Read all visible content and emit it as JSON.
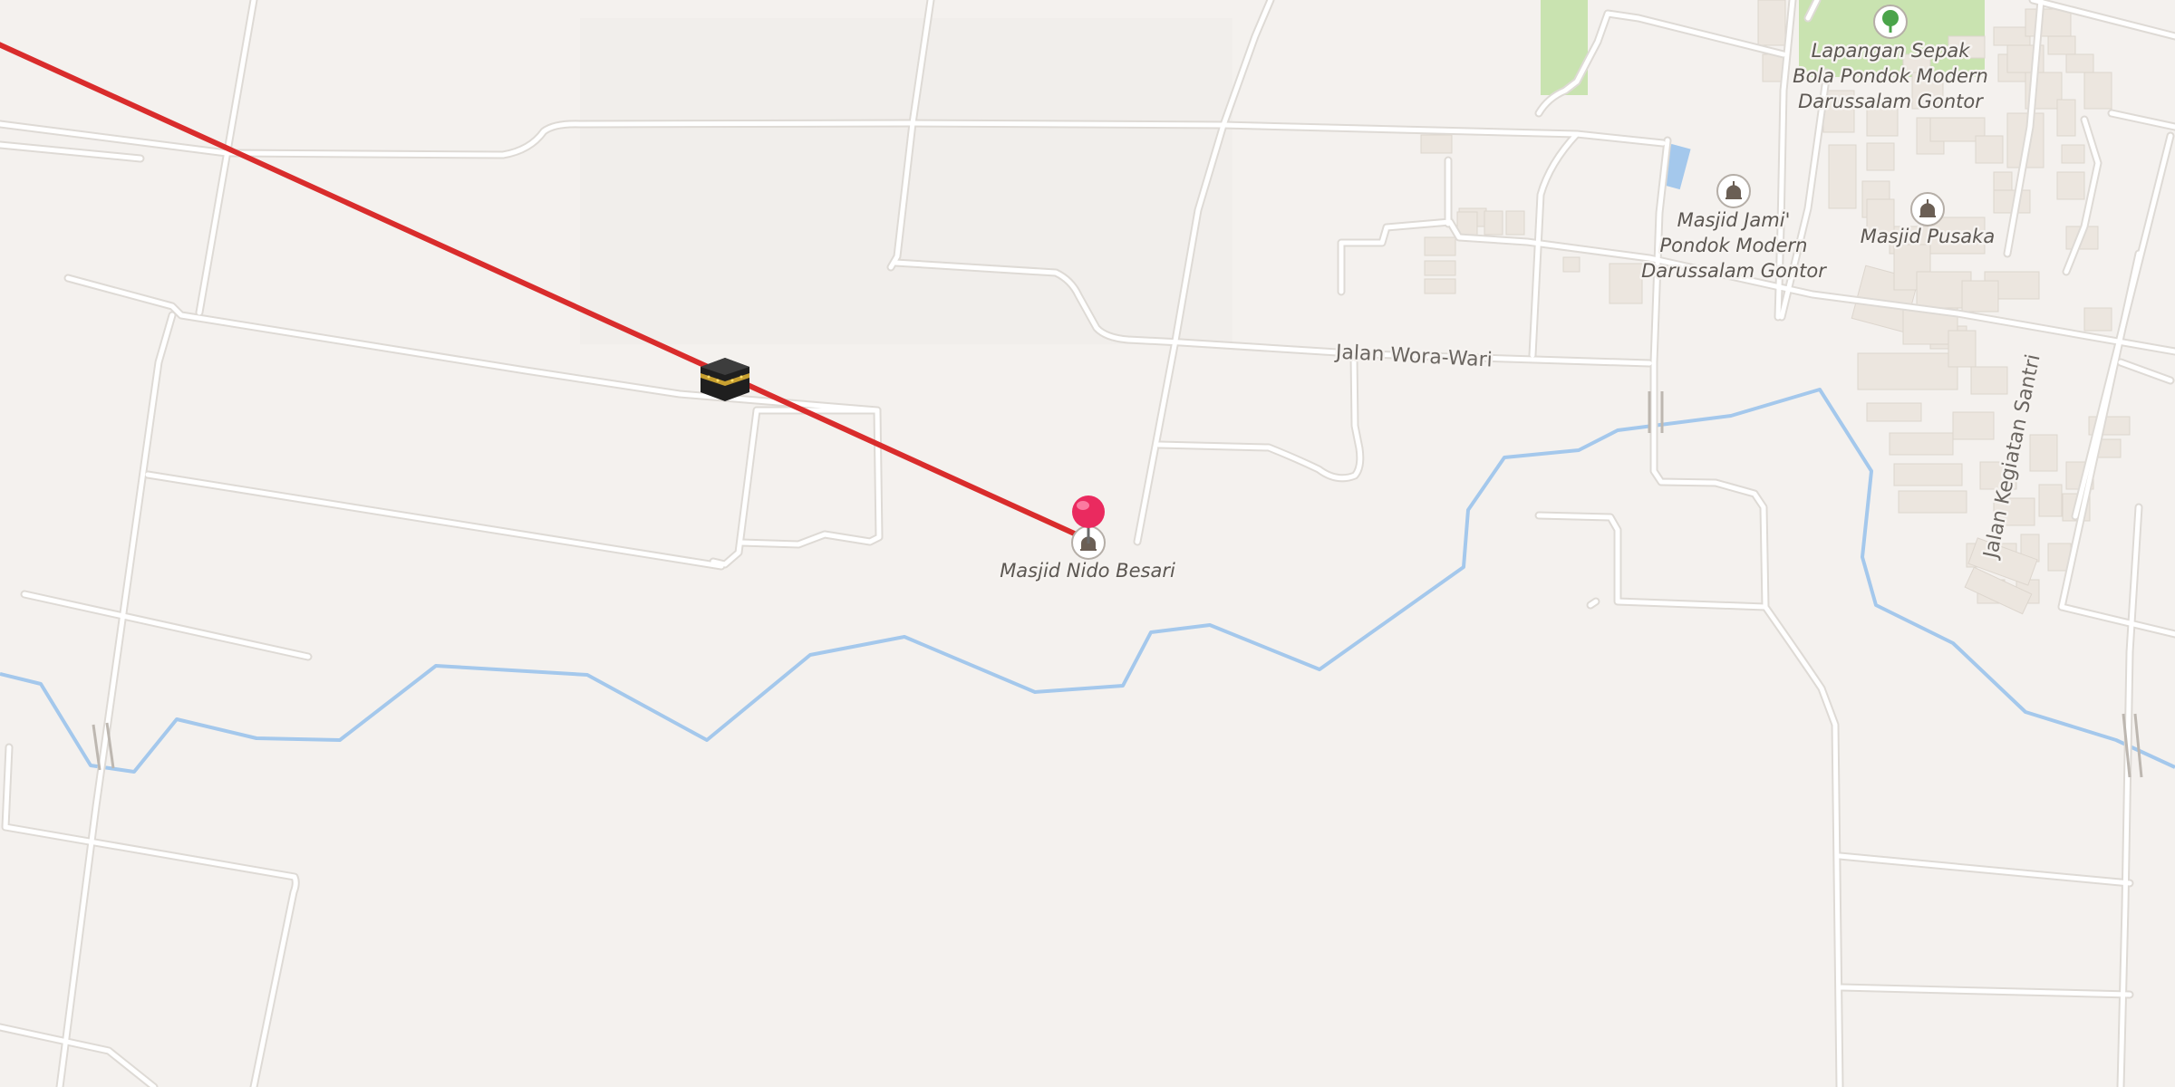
{
  "map": {
    "colors": {
      "land": "#f4f1ee",
      "road": "#ffffff",
      "road_casing": "#dedad5",
      "building": "#ece6df",
      "park": "#c9e3b0",
      "water": "#a4c8ec",
      "qibla_line": "#d92c2c",
      "pin": "#ea2a5f"
    },
    "qibla_line": {
      "icon": "kaaba-icon"
    },
    "pin": {
      "icon": "location-pin-icon"
    },
    "pois": [
      {
        "id": "masjid-nido-besari",
        "label_lines": [
          "Masjid Nido Besari"
        ],
        "icon": "mosque-icon"
      },
      {
        "id": "masjid-jami",
        "label_lines": [
          "Masjid Jami'",
          "Pondok Modern",
          "Darussalam Gontor"
        ],
        "icon": "mosque-icon"
      },
      {
        "id": "masjid-pusaka",
        "label_lines": [
          "Masjid Pusaka"
        ],
        "icon": "mosque-icon"
      },
      {
        "id": "lapangan",
        "label_lines": [
          "Lapangan Sepak",
          "Bola Pondok Modern",
          "Darussalam Gontor"
        ],
        "icon": "tree-icon"
      }
    ],
    "streets": [
      {
        "id": "jalan-wora-wari",
        "name": "Jalan Wora-Wari"
      },
      {
        "id": "jalan-kegiatan-santri",
        "name": "Jalan Kegiatan Santri"
      }
    ]
  }
}
